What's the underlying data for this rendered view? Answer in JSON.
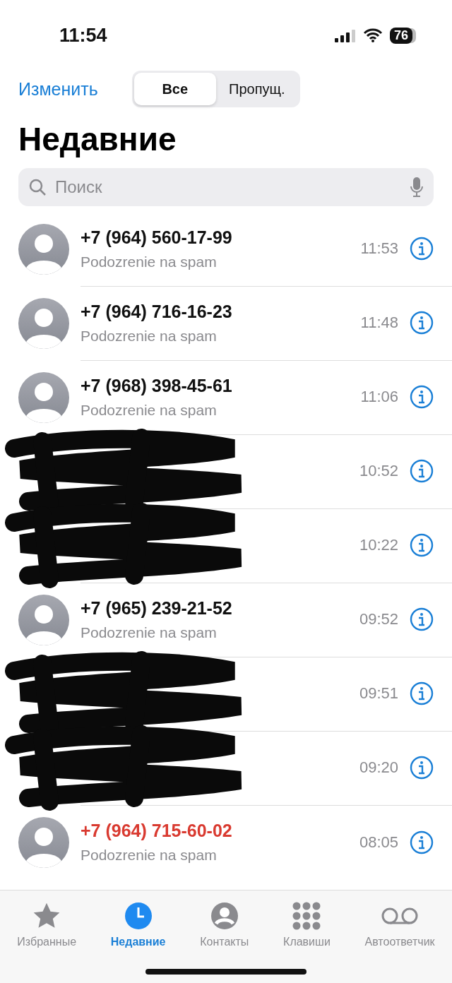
{
  "status_bar": {
    "time": "11:54",
    "battery": "76"
  },
  "nav": {
    "edit": "Изменить",
    "segments": [
      {
        "label": "Все",
        "selected": true
      },
      {
        "label": "Пропущ.",
        "selected": false
      }
    ]
  },
  "title": "Недавние",
  "search": {
    "placeholder": "Поиск"
  },
  "calls": [
    {
      "kind": "number",
      "name": "+7 (964) 560-17-99",
      "detail": "Podozrenie na spam",
      "time": "11:53",
      "missed": false
    },
    {
      "kind": "number",
      "name": "+7 (964) 716-16-23",
      "detail": "Podozrenie na spam",
      "time": "11:48",
      "missed": false
    },
    {
      "kind": "number",
      "name": "+7 (968) 398-45-61",
      "detail": "Podozrenie na spam",
      "time": "11:06",
      "missed": false
    },
    {
      "kind": "redacted",
      "time": "10:52"
    },
    {
      "kind": "redacted",
      "time": "10:22"
    },
    {
      "kind": "number",
      "name": "+7 (965) 239-21-52",
      "detail": "Podozrenie na spam",
      "time": "09:52",
      "missed": false
    },
    {
      "kind": "redacted",
      "time": "09:51"
    },
    {
      "kind": "redacted",
      "time": "09:20"
    },
    {
      "kind": "number",
      "name": "+7 (964) 715-60-02",
      "detail": "Podozrenie na spam",
      "time": "08:05",
      "missed": true
    }
  ],
  "tab_bar": [
    {
      "kind": "star",
      "label": "Избранные",
      "selected": false
    },
    {
      "kind": "clock",
      "label": "Недавние",
      "selected": true
    },
    {
      "kind": "person",
      "label": "Контакты",
      "selected": false
    },
    {
      "kind": "keypad",
      "label": "Клавиши",
      "selected": false
    },
    {
      "kind": "voicemail",
      "label": "Автоответчик",
      "selected": false
    }
  ]
}
